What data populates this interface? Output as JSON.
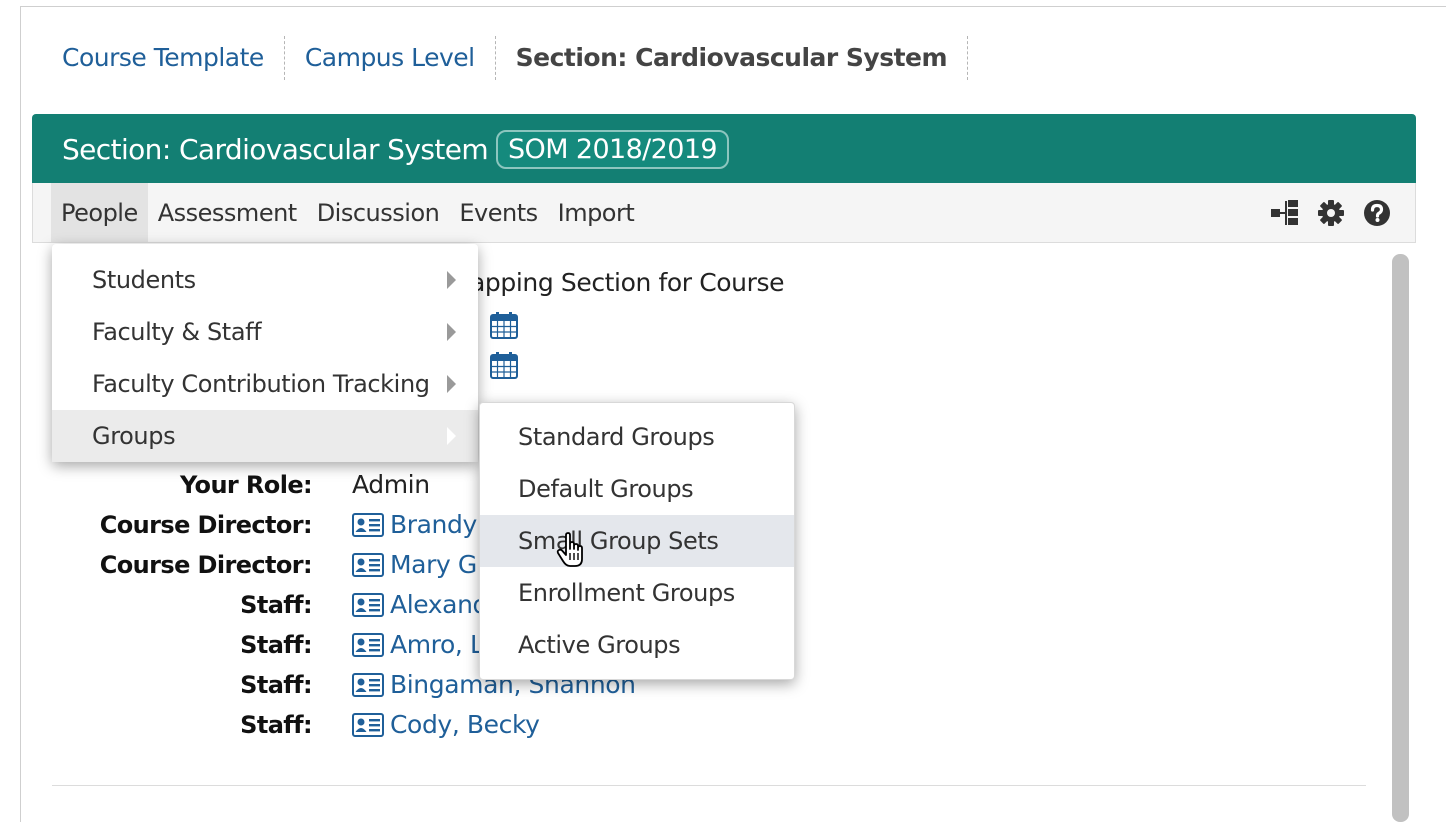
{
  "breadcrumb": [
    "Course Template",
    "Campus Level",
    "Section: Cardiovascular System"
  ],
  "panel": {
    "title": "Section: Cardiovascular System",
    "year_badge": "SOM 2018/2019"
  },
  "menubar": {
    "items": [
      "People",
      "Assessment",
      "Discussion",
      "Events",
      "Import"
    ],
    "active": "People",
    "icons": [
      "hierarchy-icon",
      "gear-icon",
      "help-icon"
    ]
  },
  "people_menu": {
    "items": [
      "Students",
      "Faculty & Staff",
      "Faculty Contribution Tracking",
      "Groups"
    ],
    "highlighted": "Groups"
  },
  "groups_submenu": {
    "items": [
      "Standard Groups",
      "Default Groups",
      "Small Group Sets",
      "Enrollment Groups",
      "Active Groups"
    ],
    "highlighted": "Small Group Sets"
  },
  "content": {
    "partial_heading": "apping Section for Course",
    "rows": [
      {
        "label": "Your Role:",
        "value": "Admin",
        "link": false
      },
      {
        "label": "Course Director:",
        "value": "Brandy",
        "link": true
      },
      {
        "label": "Course Director:",
        "value": "Mary Gr",
        "link": true
      },
      {
        "label": "Staff:",
        "value": "Alexand",
        "link": true
      },
      {
        "label": "Staff:",
        "value": "Amro, L",
        "link": true
      },
      {
        "label": "Staff:",
        "value": "Bingaman, Shannon",
        "link": true
      },
      {
        "label": "Staff:",
        "value": "Cody, Becky",
        "link": true
      }
    ]
  }
}
